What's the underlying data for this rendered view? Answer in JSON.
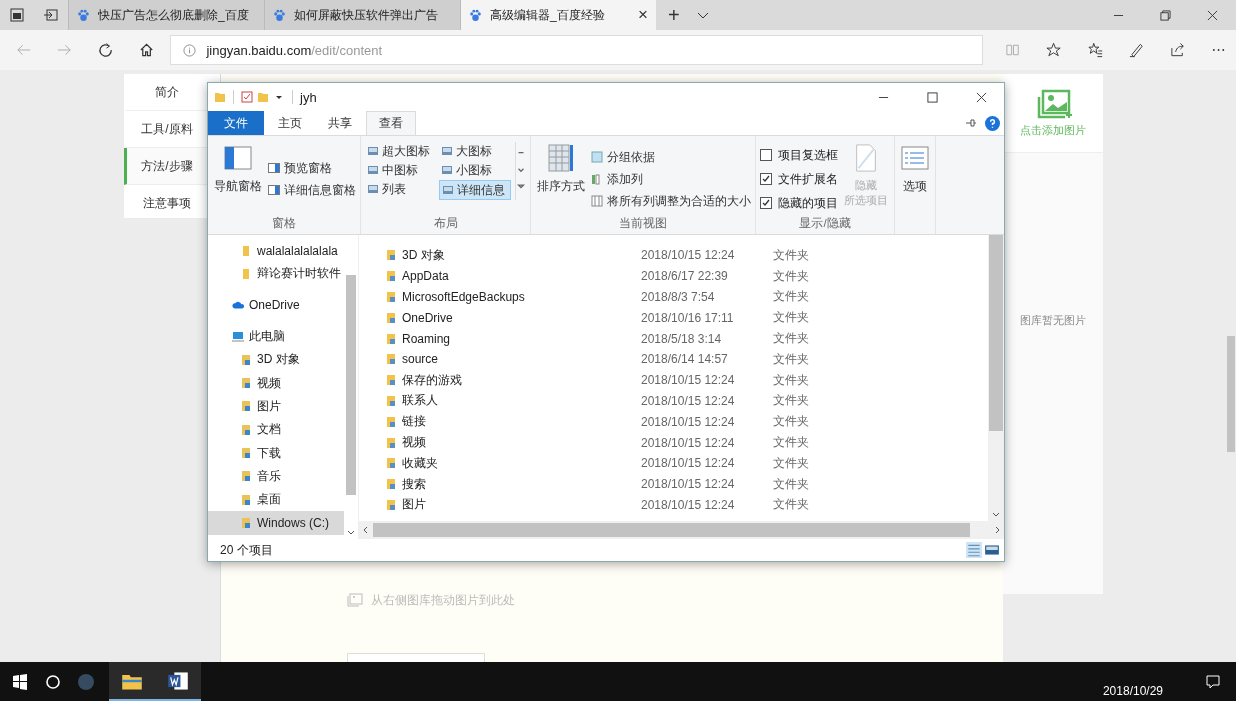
{
  "browser": {
    "tabs": [
      {
        "title": "快压广告怎么彻底删除_百度",
        "selected": false
      },
      {
        "title": "如何屏蔽快压软件弹出广告",
        "selected": false
      },
      {
        "title": "高级编辑器_百度经验",
        "selected": true
      }
    ],
    "tab_close": "×",
    "new_tab": "+",
    "address": {
      "host": "jingyan.baidu.com",
      "path": "/edit/content"
    }
  },
  "page": {
    "nav_items": [
      {
        "label": "简介",
        "selected": false
      },
      {
        "label": "工具/原料",
        "selected": false
      },
      {
        "label": "方法/步骤",
        "selected": true
      },
      {
        "label": "注意事项",
        "selected": false
      }
    ],
    "drop_hint": "从右侧图库拖动图片到此处",
    "add_image": "点击添加图片",
    "gallery_empty": "图库暂无图片"
  },
  "explorer": {
    "title": "jyh",
    "ribbon_tabs": [
      {
        "label": "文件",
        "kind": "file",
        "selected": false
      },
      {
        "label": "主页",
        "kind": "tab",
        "selected": false
      },
      {
        "label": "共享",
        "kind": "tab",
        "selected": false
      },
      {
        "label": "查看",
        "kind": "tab",
        "selected": true
      }
    ],
    "panes": {
      "group": "窗格",
      "navigation": "导航窗格",
      "preview": "预览窗格",
      "details": "详细信息窗格"
    },
    "layout": {
      "group": "布局",
      "options": [
        {
          "label": "超大图标",
          "selected": false
        },
        {
          "label": "大图标",
          "selected": false
        },
        {
          "label": "中图标",
          "selected": false
        },
        {
          "label": "小图标",
          "selected": false
        },
        {
          "label": "列表",
          "selected": false
        },
        {
          "label": "详细信息",
          "selected": true
        }
      ]
    },
    "current_view": {
      "group": "当前视图",
      "sort": "排序方式",
      "group_by": "分组依据",
      "add_column": "添加列",
      "fit_columns": "将所有列调整为合适的大小"
    },
    "show_hide": {
      "group": "显示/隐藏",
      "checkboxes": [
        {
          "label": "项目复选框",
          "checked": false
        },
        {
          "label": "文件扩展名",
          "checked": true
        },
        {
          "label": "隐藏的项目",
          "checked": true
        }
      ],
      "hide_selected": {
        "lines": [
          "隐藏",
          "所选项目"
        ],
        "disabled": true
      }
    },
    "options": "选项",
    "quick_access": [
      "walalalalalalala",
      "辩论赛计时软件"
    ],
    "onedrive": "OneDrive",
    "this_pc": {
      "label": "此电脑",
      "children": [
        {
          "label": "3D 对象",
          "selected": false
        },
        {
          "label": "视频",
          "selected": false
        },
        {
          "label": "图片",
          "selected": false
        },
        {
          "label": "文档",
          "selected": false
        },
        {
          "label": "下载",
          "selected": false
        },
        {
          "label": "音乐",
          "selected": false
        },
        {
          "label": "桌面",
          "selected": false
        },
        {
          "label": "Windows (C:)",
          "selected": true
        }
      ]
    },
    "files": [
      {
        "name": "3D 对象",
        "date": "2018/10/15 12:24",
        "type": "文件夹"
      },
      {
        "name": "AppData",
        "date": "2018/6/17 22:39",
        "type": "文件夹"
      },
      {
        "name": "MicrosoftEdgeBackups",
        "date": "2018/8/3 7:54",
        "type": "文件夹"
      },
      {
        "name": "OneDrive",
        "date": "2018/10/16 17:11",
        "type": "文件夹"
      },
      {
        "name": "Roaming",
        "date": "2018/5/18 3:14",
        "type": "文件夹"
      },
      {
        "name": "source",
        "date": "2018/6/14 14:57",
        "type": "文件夹"
      },
      {
        "name": "保存的游戏",
        "date": "2018/10/15 12:24",
        "type": "文件夹"
      },
      {
        "name": "联系人",
        "date": "2018/10/15 12:24",
        "type": "文件夹"
      },
      {
        "name": "链接",
        "date": "2018/10/15 12:24",
        "type": "文件夹"
      },
      {
        "name": "视频",
        "date": "2018/10/15 12:24",
        "type": "文件夹"
      },
      {
        "name": "收藏夹",
        "date": "2018/10/15 12:24",
        "type": "文件夹"
      },
      {
        "name": "搜索",
        "date": "2018/10/15 12:24",
        "type": "文件夹"
      },
      {
        "name": "图片",
        "date": "2018/10/15 12:24",
        "type": "文件夹"
      }
    ],
    "status": "20 个项目"
  },
  "taskbar": {
    "date": "2018/10/29"
  }
}
